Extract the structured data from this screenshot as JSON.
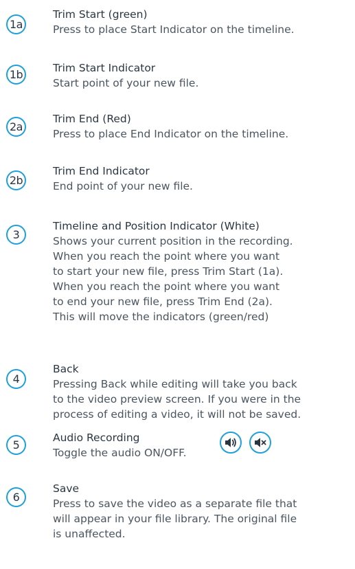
{
  "items": [
    {
      "badge": "1a",
      "title": "Trim Start (green)",
      "description": "Press to place Start Indicator on the timeline."
    },
    {
      "badge": "1b",
      "title": "Trim Start Indicator",
      "description": "Start point of your new file."
    },
    {
      "badge": "2a",
      "title": "Trim End (Red)",
      "description": "Press to place End Indicator on the timeline."
    },
    {
      "badge": "2b",
      "title": "Trim End Indicator",
      "description": "End point of your new file."
    },
    {
      "badge": "3",
      "title": "Timeline and Position Indicator (White)",
      "description": "Shows your current position in the recording.\nWhen you reach the point where you want\nto start your new file, press Trim Start (1a).\nWhen you reach the point where you want\nto end your new file, press Trim End (2a).\nThis will move the indicators (green/red)"
    },
    {
      "badge": "4",
      "title": "Back",
      "description": "Pressing Back while editing will take you back\nto the video preview screen. If you were in the\nprocess of editing a video, it will not be saved."
    },
    {
      "badge": "5",
      "title": "Audio Recording",
      "description": "Toggle the audio ON/OFF.",
      "icons": [
        "speaker-on-icon",
        "speaker-muted-icon"
      ]
    },
    {
      "badge": "6",
      "title": "Save",
      "description": "Press to save the video as a separate file that\nwill appear in your file library. The original file\nis unaffected."
    }
  ],
  "colors": {
    "accent": "#1f9fdc",
    "title_text": "#2a3642",
    "body_text": "#4a5560"
  }
}
